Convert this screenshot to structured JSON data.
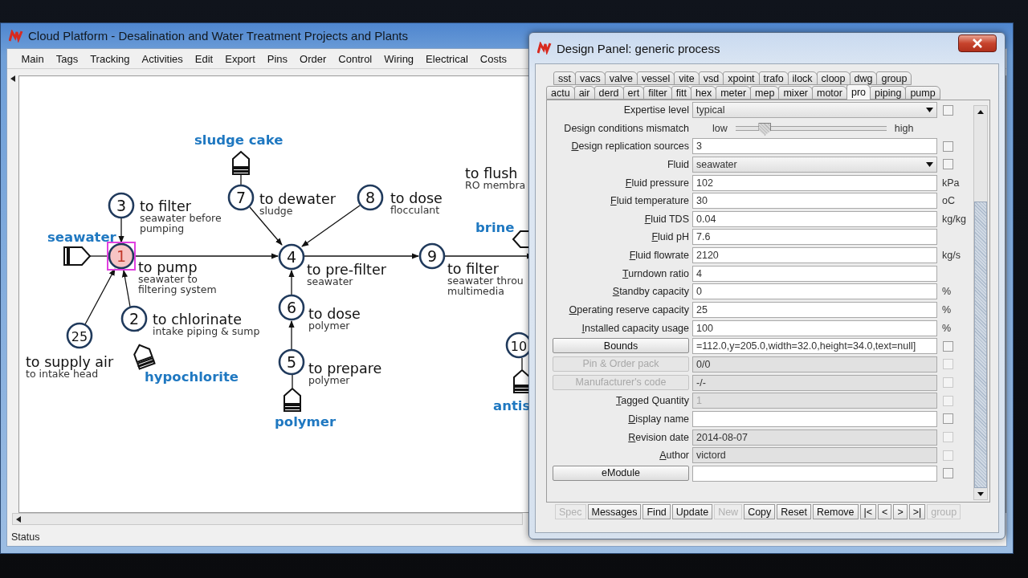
{
  "main_window": {
    "title": "Cloud Platform - Desalination and Water Treatment Projects and Plants",
    "menu": [
      "Main",
      "Tags",
      "Tracking",
      "Activities",
      "Edit",
      "Export",
      "Pins",
      "Order",
      "Control",
      "Wiring",
      "Electrical",
      "Costs"
    ],
    "status": "Status"
  },
  "diagram": {
    "nodes": [
      {
        "title": "to flush",
        "note_lines": [
          "RO  membra"
        ]
      },
      {
        "number": "7",
        "title": "to dewater",
        "note_lines": [
          "sludge"
        ],
        "selected": false
      },
      {
        "number": "8",
        "title": "to dose",
        "note_lines": [
          "flocculant"
        ],
        "selected": false
      },
      {
        "number": "3",
        "title": "to filter",
        "note_lines": [
          "seawater before",
          "pumping"
        ],
        "selected": false
      },
      {
        "number": "1",
        "title": "to pump",
        "note_lines": [
          "seawater to",
          "filtering system"
        ],
        "selected": true
      },
      {
        "number": "4",
        "title": "to pre-filter",
        "note_lines": [
          "seawater"
        ],
        "selected": false
      },
      {
        "number": "9",
        "title": "to filter",
        "note_lines": [
          "seawater throu",
          "multimedia"
        ],
        "selected": false
      },
      {
        "number": "6",
        "title": "to dose",
        "note_lines": [
          "polymer"
        ],
        "selected": false
      },
      {
        "number": "2",
        "title": "to chlorinate",
        "note_lines": [
          "intake piping & sump"
        ],
        "selected": false
      },
      {
        "number": "25",
        "title": "to supply air",
        "note_lines": [
          "to intake head"
        ],
        "selected": false
      },
      {
        "number": "10",
        "selected": false
      },
      {
        "number": "5",
        "title": "to prepare",
        "note_lines": [
          "polymer"
        ],
        "selected": false
      }
    ],
    "streams": [
      {
        "name": "seawater",
        "kind": "source"
      },
      {
        "name": "sludge cake",
        "kind": "tank"
      },
      {
        "name": "hypochlorite",
        "kind": "tank"
      },
      {
        "name": "polymer",
        "kind": "tank"
      },
      {
        "name": "brine",
        "kind": "outlet"
      },
      {
        "name": "antis",
        "kind": "tank"
      }
    ]
  },
  "design_panel": {
    "title": "Design Panel: generic process",
    "tab_rows": [
      [
        {
          "label": "sst",
          "selected": false
        },
        {
          "label": "vacs",
          "selected": false
        },
        {
          "label": "valve",
          "selected": false
        },
        {
          "label": "vessel",
          "selected": false
        },
        {
          "label": "vite",
          "selected": false
        },
        {
          "label": "vsd",
          "selected": false
        },
        {
          "label": "xpoint",
          "selected": false
        },
        {
          "label": "trafo",
          "selected": false
        },
        {
          "label": "ilock",
          "selected": false
        },
        {
          "label": "cloop",
          "selected": false
        },
        {
          "label": "dwg",
          "selected": false
        },
        {
          "label": "group",
          "selected": false
        }
      ],
      [
        {
          "label": "actu",
          "selected": false
        },
        {
          "label": "air",
          "selected": false
        },
        {
          "label": "derd",
          "selected": false
        },
        {
          "label": "ert",
          "selected": false
        },
        {
          "label": "filter",
          "selected": false
        },
        {
          "label": "fitt",
          "selected": false
        },
        {
          "label": "hex",
          "selected": false
        },
        {
          "label": "meter",
          "selected": false
        },
        {
          "label": "mep",
          "selected": false
        },
        {
          "label": "mixer",
          "selected": false
        },
        {
          "label": "motor",
          "selected": false
        },
        {
          "label": "pro",
          "selected": true
        },
        {
          "label": "piping",
          "selected": false
        },
        {
          "label": "pump",
          "selected": false
        }
      ]
    ],
    "rows": [
      {
        "kind": "select",
        "label": "Expertise level",
        "value": "typical",
        "checked": false
      },
      {
        "kind": "slider",
        "label": "Design conditions mismatch",
        "low": "low",
        "high": "high",
        "level": 0.19
      },
      {
        "kind": "field",
        "label": "Design replication sources",
        "value": "3",
        "editable": true,
        "disabled": false,
        "checked": false
      },
      {
        "kind": "select",
        "label": "Fluid",
        "value": "seawater",
        "checked": false
      },
      {
        "kind": "field",
        "label": "Fluid pressure",
        "value": "102",
        "editable": true,
        "disabled": false,
        "unit": "kPa"
      },
      {
        "kind": "field",
        "label": "Fluid temperature",
        "value": "30",
        "editable": true,
        "disabled": false,
        "unit": "oC"
      },
      {
        "kind": "field",
        "label": "Fluid TDS",
        "value": "0.04",
        "editable": true,
        "disabled": false,
        "unit": "kg/kg"
      },
      {
        "kind": "field",
        "label": "Fluid pH",
        "value": "7.6",
        "editable": true,
        "disabled": false
      },
      {
        "kind": "field",
        "label": "Fluid flowrate",
        "value": "2120",
        "editable": true,
        "disabled": false,
        "unit": "kg/s"
      },
      {
        "kind": "field",
        "label": "Turndown ratio",
        "value": "4",
        "editable": true,
        "disabled": false
      },
      {
        "kind": "field",
        "label": "Standby capacity",
        "value": "0",
        "editable": true,
        "disabled": false,
        "unit": "%"
      },
      {
        "kind": "field",
        "label": "Operating reserve capacity",
        "value": "25",
        "editable": true,
        "disabled": false,
        "unit": "%"
      },
      {
        "kind": "field",
        "label": "Installed capacity usage",
        "value": "100",
        "editable": true,
        "disabled": false,
        "unit": "%"
      },
      {
        "kind": "button",
        "label": "Bounds",
        "disabled": false,
        "value": "=112.0,y=205.0,width=32.0,height=34.0,text=null]",
        "editable": true,
        "checked": false
      },
      {
        "kind": "button",
        "label": "Pin & Order pack",
        "disabled": true,
        "value": "0/0",
        "editable": false,
        "checked": false
      },
      {
        "kind": "button",
        "label": "Manufacturer's code",
        "disabled": true,
        "value": "-/-",
        "editable": false,
        "checked": false
      },
      {
        "kind": "field",
        "label": "Tagged Quantity",
        "value": "1",
        "editable": false,
        "disabled": true,
        "checked": false
      },
      {
        "kind": "field",
        "label": "Display name",
        "editable": true,
        "disabled": false,
        "checked": false
      },
      {
        "kind": "field",
        "label": "Revision date",
        "value": "2014-08-07",
        "editable": false,
        "disabled": false,
        "checked": false
      },
      {
        "kind": "field",
        "label": "Author",
        "value": "victord",
        "editable": false,
        "disabled": false,
        "checked": false
      },
      {
        "kind": "button",
        "label": "eModule",
        "disabled": false,
        "editable": true,
        "checked": false
      }
    ],
    "buttons": [
      {
        "label": "Spec",
        "disabled": true
      },
      {
        "label": "Messages",
        "disabled": false
      },
      {
        "label": "Find",
        "disabled": false
      },
      {
        "label": "Update",
        "disabled": false
      },
      {
        "label": "New",
        "disabled": true
      },
      {
        "label": "Copy",
        "disabled": false
      },
      {
        "label": "Reset",
        "disabled": false
      },
      {
        "label": "Remove",
        "disabled": false
      },
      {
        "label": "|<",
        "disabled": false
      },
      {
        "label": "<",
        "disabled": false
      },
      {
        "label": ">",
        "disabled": false
      },
      {
        "label": ">|",
        "disabled": false
      },
      {
        "label": "group",
        "disabled": true
      }
    ]
  }
}
